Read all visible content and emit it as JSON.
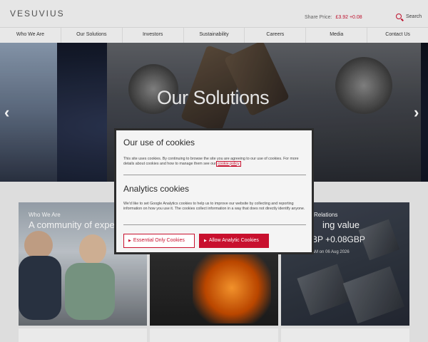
{
  "header": {
    "logo": "VESUVIUS",
    "share_price_label": "Share Price:",
    "share_price_value": "£3.92 +0.08",
    "search_label": "Search"
  },
  "nav": {
    "items": [
      {
        "label": "Who We Are"
      },
      {
        "label": "Our Solutions"
      },
      {
        "label": "Investors"
      },
      {
        "label": "Sustainability"
      },
      {
        "label": "Careers"
      },
      {
        "label": "Media"
      },
      {
        "label": "Contact Us"
      }
    ]
  },
  "hero": {
    "title": "Our Solutions",
    "prev_arrow": "‹",
    "next_arrow": "›"
  },
  "tiles": [
    {
      "label": "Who We Are",
      "heading": "A community of expe"
    },
    {
      "label": "",
      "heading": ""
    },
    {
      "label": "Relations",
      "heading": "ing value",
      "price": "BP +0.08GBP",
      "date": "AM on 06 Aug 2026"
    }
  ],
  "cookie_modal": {
    "title": "Our use of cookies",
    "intro": "This site uses cookies. By continuing to browse the site you are agreeing to our use of cookies. For more details about cookies and how to manage them see our",
    "policy_link": "cookie policy",
    "analytics_title": "Analytics cookies",
    "analytics_text": "We'd like to set Google Analytics cookies to help us to improve our website by collecting and reporting information on how you use it. The cookies collect information in a way that does not directly identify anyone.",
    "btn_essential": "Essential Only Cookies",
    "btn_analytics": "Allow Analytic Cookies"
  },
  "colors": {
    "accent": "#c8102e",
    "modal_border": "#2c2c2c"
  },
  "icons": {
    "search": "search-icon",
    "arrow_left": "chevron-left-icon",
    "arrow_right": "chevron-right-icon",
    "button_caret": "caret-right-icon"
  }
}
